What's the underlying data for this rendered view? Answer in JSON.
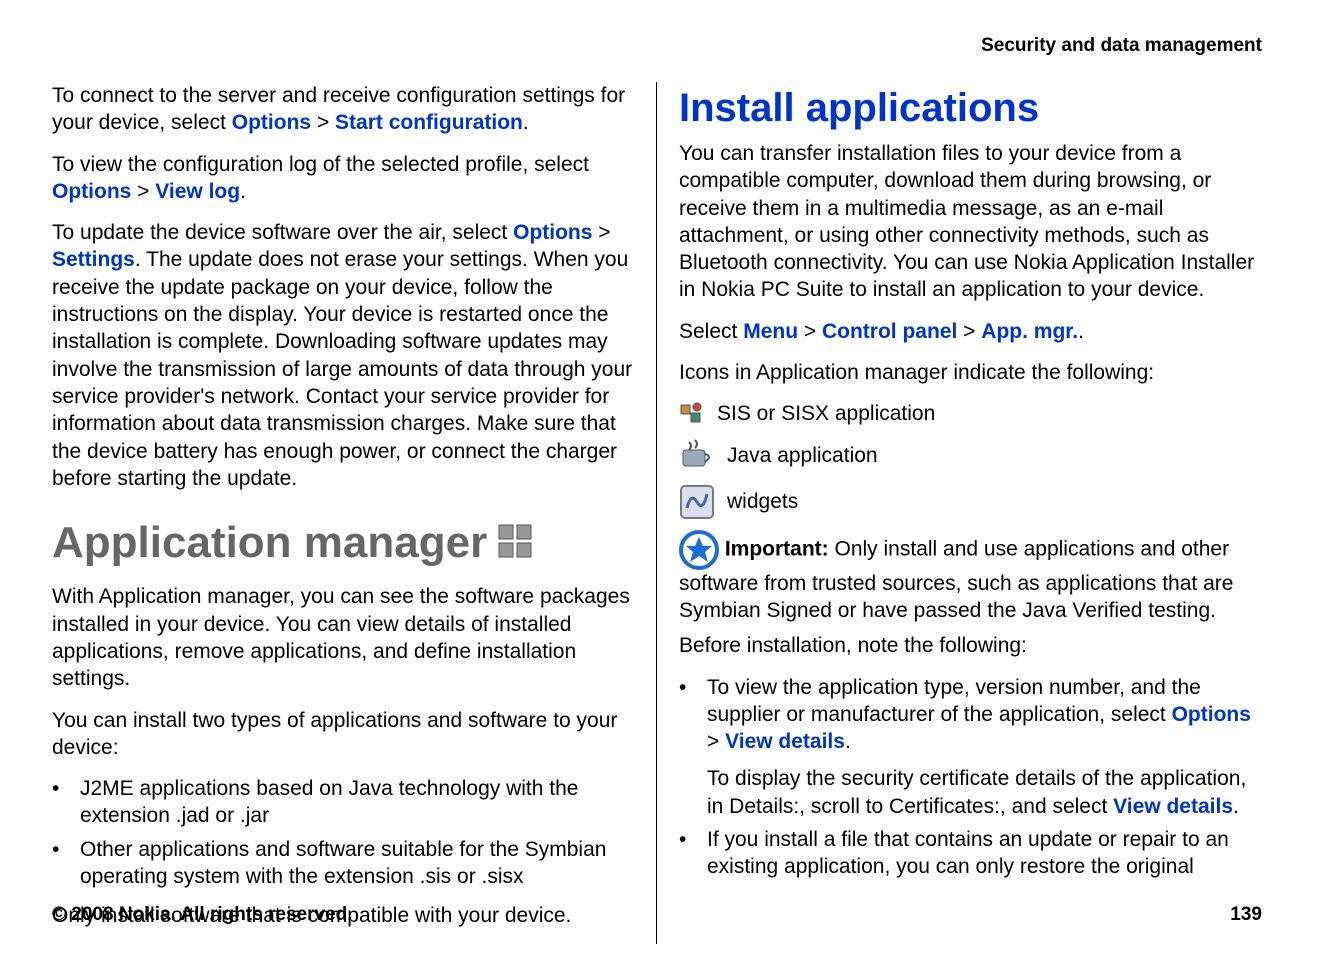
{
  "header": {
    "section_title": "Security and data management"
  },
  "left": {
    "p1_pre": "To connect to the server and receive configuration settings for your device, select ",
    "p1_l1": "Options",
    "p1_l2": "Start configuration",
    "p1_post": ".",
    "p2_pre": "To view the configuration log of the selected profile, select ",
    "p2_l1": "Options",
    "p2_l2": "View log",
    "p2_post": ".",
    "p3_pre": "To update the device software over the air, select ",
    "p3_l1": "Options",
    "p3_l2": "Settings",
    "p3_post": ". The update does not erase your settings. When you receive the update package on your device, follow the instructions on the display. Your device is restarted once the installation is complete. Downloading software updates may involve the transmission of large amounts of data through your service provider's network. Contact your service provider for information about data transmission charges. Make sure that the device battery has enough power, or connect the charger before starting the update.",
    "h1": "Application manager",
    "p4": "With Application manager, you can see the software packages installed in your device. You can view details of installed applications, remove applications, and define installation settings.",
    "p5": "You can install two types of applications and software to your device:",
    "bullets": [
      "J2ME applications based on Java technology with the extension .jad or .jar",
      "Other applications and software suitable for the Symbian operating system with the extension .sis or .sisx"
    ],
    "p6": "Only install software that is compatible with your device."
  },
  "right": {
    "h2": "Install applications",
    "p1": "You can transfer installation files to your device from a compatible computer, download them during browsing, or receive them in a multimedia message, as an e-mail attachment, or using other connectivity methods, such as Bluetooth connectivity. You can use Nokia Application Installer in Nokia PC Suite to install an application to your device.",
    "p2_pre": "Select ",
    "p2_l1": "Menu",
    "p2_l2": "Control panel",
    "p2_l3": "App. mgr.",
    "p2_post": ".",
    "p3": "Icons in Application manager indicate the following:",
    "icon1": "SIS or SISX application",
    "icon2": "Java application",
    "icon3": "widgets",
    "important_label": "Important:",
    "important_text": " Only install and use applications and other software from trusted sources, such as applications that are Symbian Signed or have passed the Java Verified testing.",
    "p4": "Before installation, note the following:",
    "b1_a_pre": "To view the application type, version number, and the supplier or manufacturer of the application, select ",
    "b1_a_l1": "Options",
    "b1_a_l2": "View details",
    "b1_a_post": ".",
    "b1_b_pre": "To display the security certificate details of the application, in Details:, scroll to Certificates:, and select ",
    "b1_b_l1": "View details",
    "b1_b_post": ".",
    "b2": "If you install a file that contains an update or repair to an existing application, you can only restore the original"
  },
  "footer": {
    "copyright": "© 2008 Nokia. All rights reserved.",
    "page": "139"
  }
}
